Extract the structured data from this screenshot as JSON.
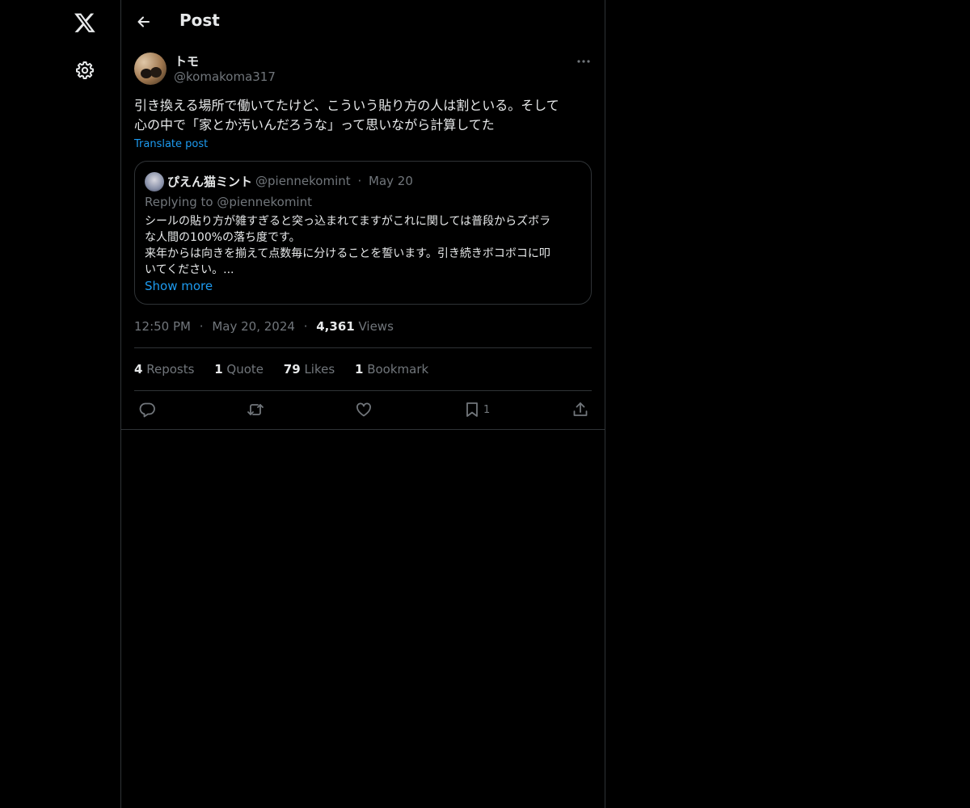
{
  "app": {
    "icon": "x-logo-icon"
  },
  "sidebar": {
    "settings_icon": "gear-icon"
  },
  "header": {
    "title": "Post",
    "back_icon": "arrow-left-icon"
  },
  "post": {
    "author_name": "トモ",
    "author_handle": "@komakoma317",
    "text_line1": "引き換える場所で働いてたけど、こういう貼り方の人は割といる。そして",
    "text_line2": "心の中で「家とか汚いんだろうな」って思いながら計算してた",
    "translate_label": "Translate post",
    "time": "12:50 PM",
    "date": "May 20, 2024",
    "views_count": "4,361",
    "views_label": "Views",
    "sep": "·"
  },
  "quote": {
    "name": "ぴえん猫ミント",
    "handle": "@piennekomint",
    "date": "May 20",
    "replying": "Replying to @piennekomint",
    "line1": "シールの貼り方が雑すぎると突っ込まれてますがこれに関しては普段からズボラ",
    "line2": "な人間の100%の落ち度です。",
    "line3": "来年からは向きを揃えて点数毎に分けることを誓います。引き続きボコボコに叩",
    "line4": "いてください。...",
    "show_more": "Show more"
  },
  "stats": {
    "reposts_count": "4",
    "reposts_label": "Reposts",
    "quote_count": "1",
    "quote_label": "Quote",
    "likes_count": "79",
    "likes_label": "Likes",
    "bookmark_count": "1",
    "bookmark_label": "Bookmark"
  },
  "actions": {
    "reply_icon": "reply-icon",
    "repost_icon": "repost-icon",
    "like_icon": "heart-icon",
    "bookmark_icon": "bookmark-icon",
    "bookmark_count": "1",
    "share_icon": "share-icon"
  },
  "colors": {
    "background": "#000000",
    "text": "#e7e9ea",
    "muted": "#71767b",
    "accent": "#1d9bf0",
    "border": "#2f3336"
  }
}
